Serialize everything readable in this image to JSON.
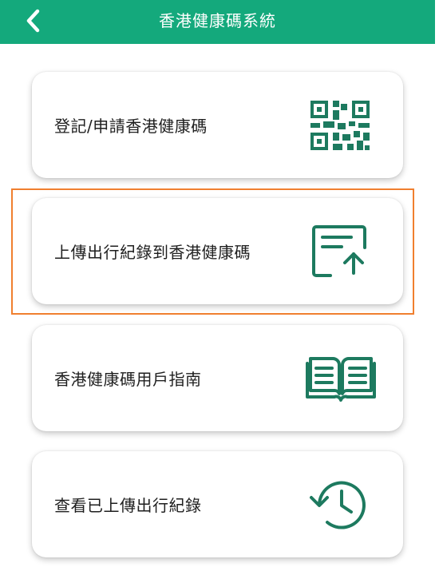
{
  "header": {
    "title": "香港健康碼系統",
    "back_icon": "chevron-left-icon",
    "background_color": "#14a97c"
  },
  "menu": [
    {
      "label": "登記/申請香港健康碼",
      "icon": "qr-code-icon"
    },
    {
      "label": "上傳出行紀錄到香港健康碼",
      "icon": "document-upload-icon"
    },
    {
      "label": "香港健康碼用戶指南",
      "icon": "open-book-icon"
    },
    {
      "label": "查看已上傳出行紀錄",
      "icon": "history-clock-icon"
    }
  ],
  "accent_color": "#1d7a5f",
  "highlight_color": "#f07f2f"
}
